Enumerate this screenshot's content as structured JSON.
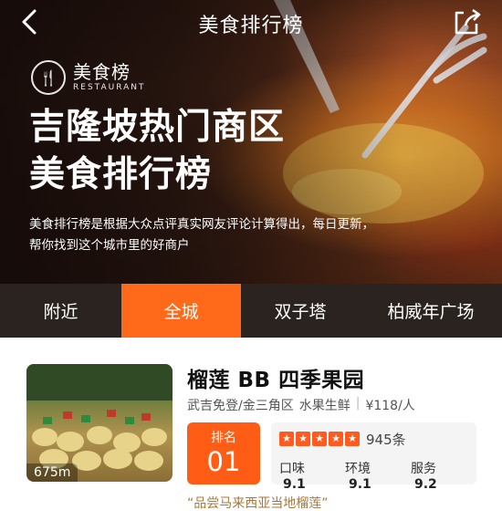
{
  "header": {
    "title": "美食排行榜",
    "back_icon": "chevron-left-icon",
    "share_icon": "share-icon"
  },
  "hero": {
    "brand_name": "美食榜",
    "brand_sub": "RESTAURANT",
    "headline_line1": "吉隆坡热门商区",
    "headline_line2": "美食排行榜",
    "description": "美食排行榜是根据大众点评真实网友评论计算得出，每日更新，帮你找到这个城市里的好商户"
  },
  "tabs": [
    {
      "label": "附近",
      "active": false
    },
    {
      "label": "全城",
      "active": true
    },
    {
      "label": "双子塔",
      "active": false
    },
    {
      "label": "柏威年广场",
      "active": false
    }
  ],
  "listing": {
    "name": "榴莲 BB 四季果园",
    "distance": "675m",
    "area": "武吉免登/金三角区",
    "category": "水果生鲜",
    "price": "¥118/人",
    "rank_label": "排名",
    "rank": "01",
    "stars": 5,
    "review_count": "945条",
    "scores": [
      {
        "label": "口味",
        "value": "9.1"
      },
      {
        "label": "环境",
        "value": "9.1"
      },
      {
        "label": "服务",
        "value": "9.2"
      }
    ],
    "quote": "“品尝马来西亚当地榴莲”"
  },
  "colors": {
    "accent": "#ff6a1a",
    "tab_bar": "#2b2320",
    "quote": "#a8783a"
  }
}
